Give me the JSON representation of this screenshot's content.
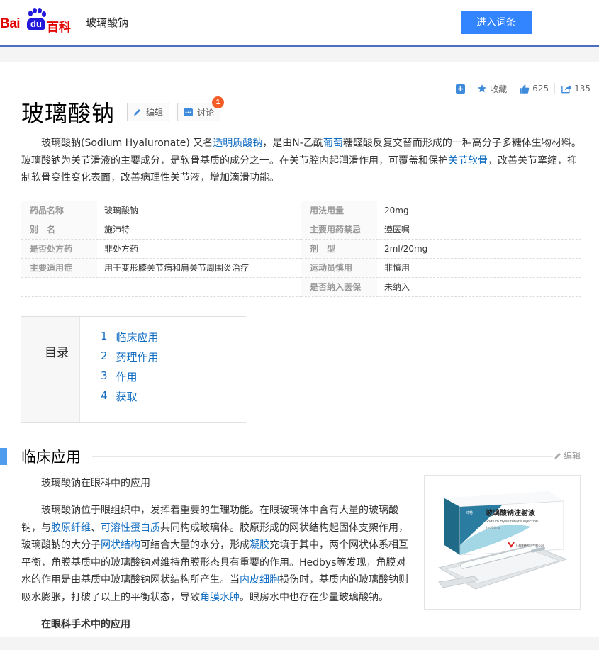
{
  "header": {
    "logo_bai": "Bai",
    "logo_du": "du",
    "logo_baike": "百科",
    "search_value": "玻璃酸钠",
    "search_button": "进入词条"
  },
  "actions": {
    "collect_label": "收藏",
    "like_count": "625",
    "share_count": "135"
  },
  "title": "玻璃酸钠",
  "title_buttons": {
    "edit": "编辑",
    "discuss": "讨论",
    "discuss_badge": "1"
  },
  "summary": {
    "t1": "玻璃酸钠(Sodium Hyaluronate) 又名",
    "link1": "透明质酸钠",
    "t2": "，是由N-乙酰",
    "link2": "葡萄",
    "t3": "糖醛酸反复交替而形成的一种高分子多糖体生物材料。玻璃酸钠为关节滑液的主要成分，是软骨基质的成分之一。在关节腔内起润滑作用，可覆盖和保护",
    "link3": "关节软骨",
    "t4": "，改善关节挛缩，抑制软骨变性变化表面，改善病理性关节液，增加滴滑功能。"
  },
  "info": {
    "left": [
      {
        "k": "药品名称",
        "v": "玻璃酸钠"
      },
      {
        "k": "别　名",
        "v": "施沛特"
      },
      {
        "k": "是否处方药",
        "v": "非处方药"
      },
      {
        "k": "主要适用症",
        "v": "用于变形膝关节病和肩关节周围炎治疗"
      }
    ],
    "right": [
      {
        "k": "用法用量",
        "v": "20mg"
      },
      {
        "k": "主要用药禁忌",
        "v": "遵医嘱"
      },
      {
        "k": "剂　型",
        "v": "2ml/20mg"
      },
      {
        "k": "运动员慎用",
        "v": "非慎用"
      },
      {
        "k": "是否纳入医保",
        "v": "未纳入"
      }
    ]
  },
  "toc": {
    "label": "目录",
    "items": [
      {
        "num": "1",
        "text": "临床应用"
      },
      {
        "num": "2",
        "text": "药理作用"
      },
      {
        "num": "3",
        "text": "作用"
      },
      {
        "num": "4",
        "text": "获取"
      }
    ]
  },
  "section": {
    "title": "临床应用",
    "edit": "编辑",
    "p1": "玻璃酸钠在眼科中的应用",
    "p2": {
      "a": "玻璃酸钠位于眼组织中，发挥着重要的生理功能。在眼玻璃体中含有大量的玻璃酸钠，与",
      "l1": "胶原纤维",
      "b": "、",
      "l2": "可溶性蛋白质",
      "c": "共同构成玻璃体。胶原形成的网状结构起固体支架作用，玻璃酸钠的大分子",
      "l3": "网状结构",
      "d": "可结合大量的水分，形成",
      "l4": "凝胶",
      "e": "充填于其中，两个网状体系相互平衡，角膜基质中的玻璃酸钠对维持角膜形态具有重要的作用。Hedbys等发现，角膜对水的作用是由基质中玻璃酸钠网状结构所产生。当",
      "l5": "内皮细胞",
      "f": "损伤时，基质内的玻璃酸钠则吸水膨胀，打破了以上的平衡状态，导致",
      "l6": "角膜水肿",
      "g": "。眼房水中也存在少量玻璃酸钠。"
    },
    "subhead": "在眼科手术中的应用"
  },
  "figure": {
    "box_title": "玻璃酸钠注射液",
    "box_subtitle": "Sodium Hyaluronate Injection",
    "box_small": "2ml/20mg",
    "box_maker": "上海景峰制药有限公司",
    "box_brand": "沛特"
  }
}
